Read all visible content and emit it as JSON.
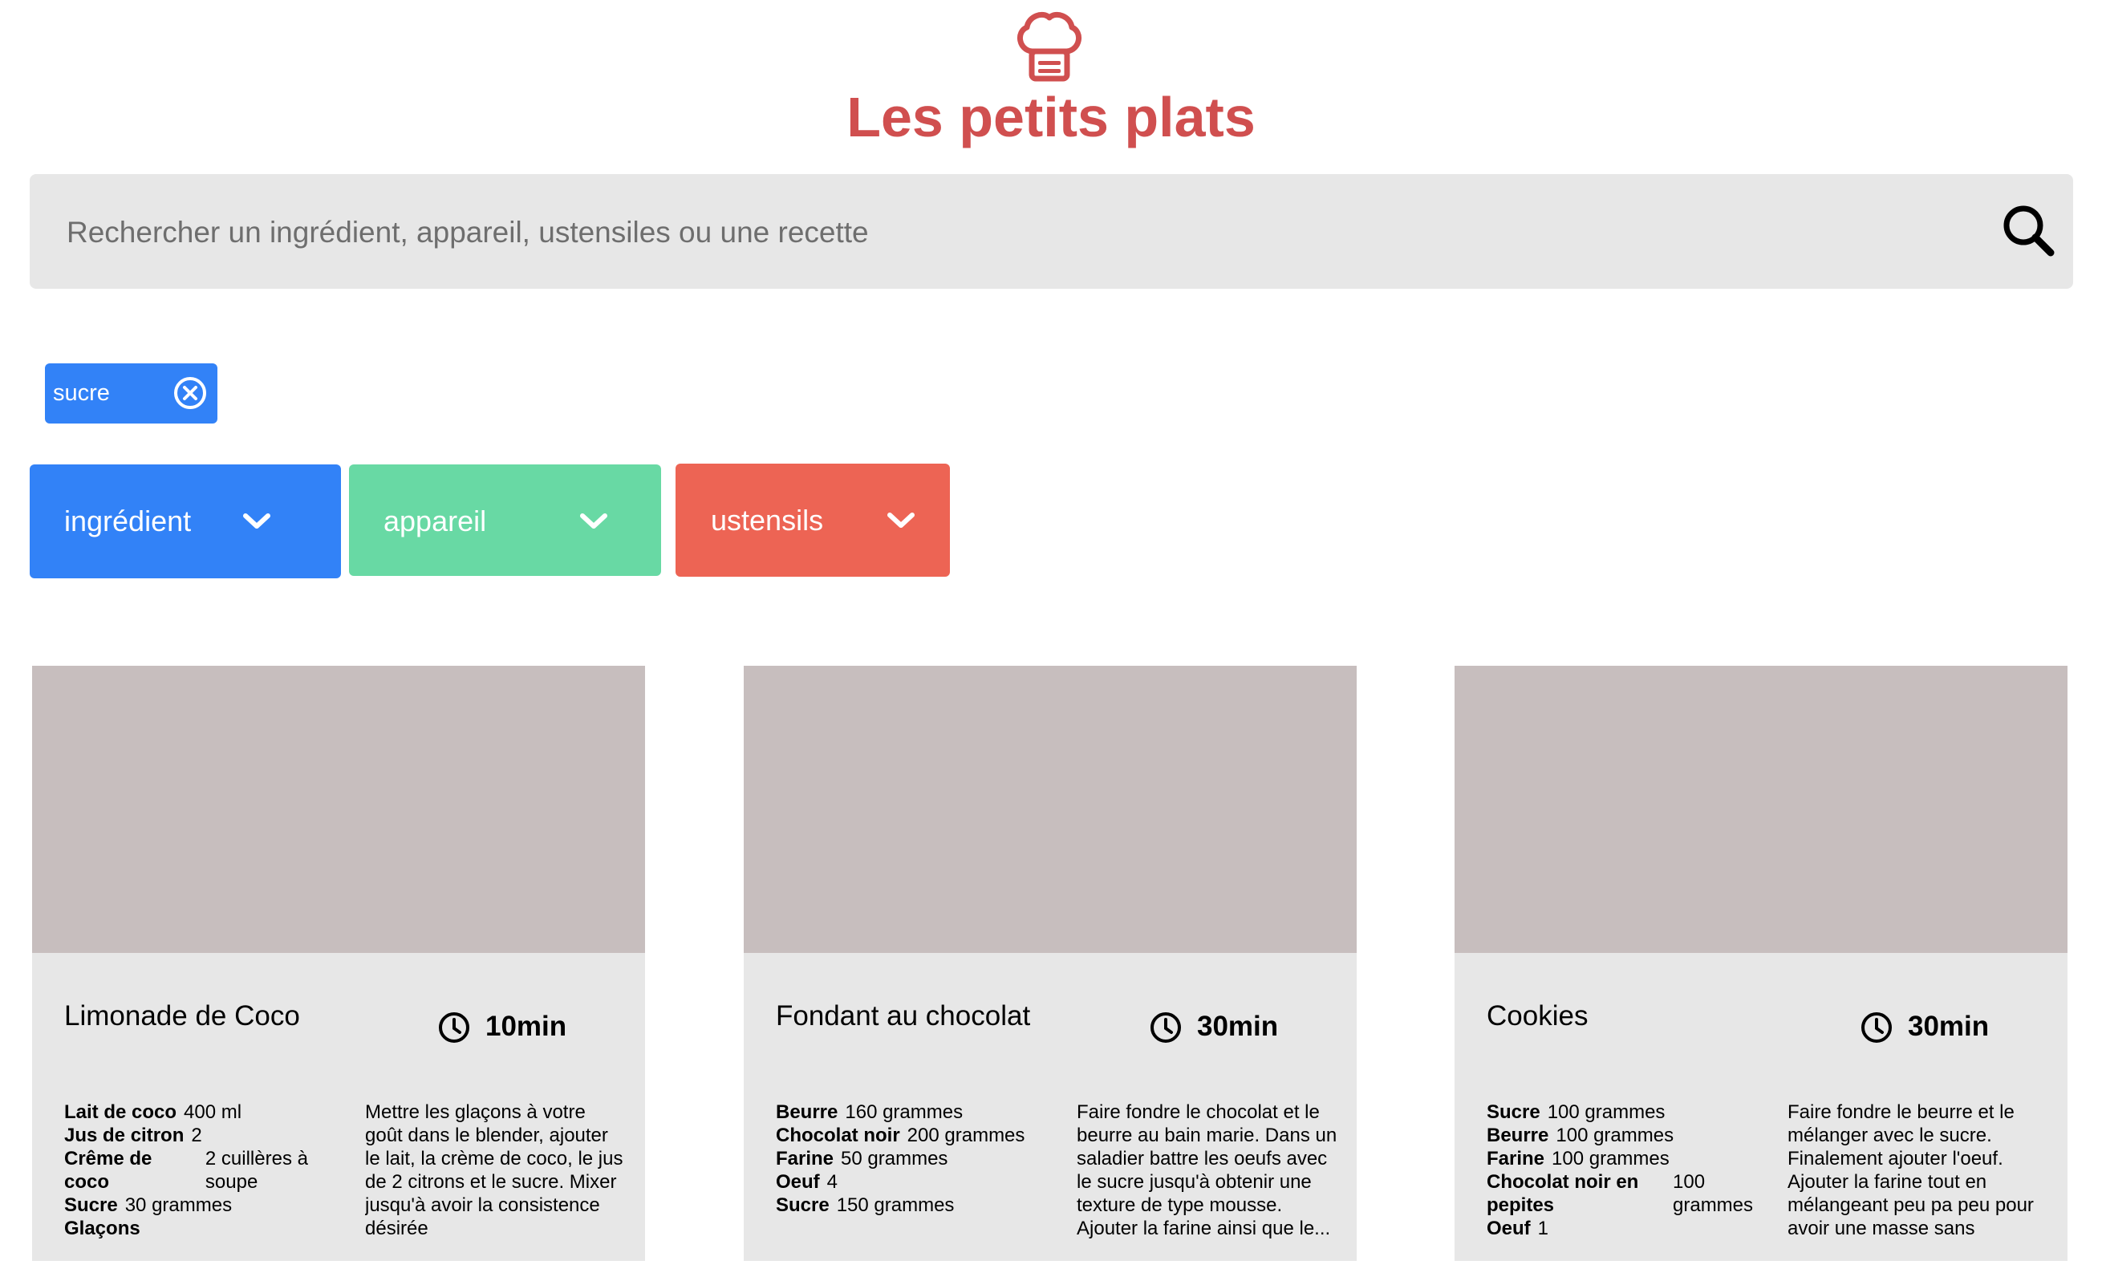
{
  "header": {
    "logo_icon": "chef-hat-icon",
    "title": "Les petits plats",
    "title_color": "#D04F4F"
  },
  "search": {
    "placeholder": "Rechercher un ingrédient, appareil, ustensiles ou une recette",
    "value": "",
    "icon": "search-icon"
  },
  "tags": [
    {
      "label": "sucre",
      "color": "#3282F7",
      "icon": "close-circle-icon"
    }
  ],
  "filters": [
    {
      "label": "ingrédient",
      "color": "#3282F7",
      "icon": "chevron-down-icon"
    },
    {
      "label": "appareil",
      "color": "#68D9A4",
      "icon": "chevron-down-icon"
    },
    {
      "label": "ustensils",
      "color": "#ED6454",
      "icon": "chevron-down-icon"
    }
  ],
  "recipes": [
    {
      "title": "Limonade de Coco",
      "time": "10min",
      "ingredients": [
        {
          "name": "Lait de coco",
          "qty": "400 ml"
        },
        {
          "name": "Jus de citron",
          "qty": "2"
        },
        {
          "name": "Crême de coco",
          "qty": "2 cuillères à soupe"
        },
        {
          "name": "Sucre",
          "qty": "30 grammes"
        },
        {
          "name": "Glaçons",
          "qty": ""
        }
      ],
      "description": "Mettre les glaçons à votre goût dans le blender, ajouter le lait, la crème de coco, le jus de 2 citrons et le sucre. Mixer jusqu'à avoir la consistence désirée"
    },
    {
      "title": "Fondant au chocolat",
      "time": "30min",
      "ingredients": [
        {
          "name": "Beurre",
          "qty": "160 grammes"
        },
        {
          "name": "Chocolat noir",
          "qty": "200 grammes"
        },
        {
          "name": "Farine",
          "qty": "50 grammes"
        },
        {
          "name": "Oeuf",
          "qty": "4"
        },
        {
          "name": "Sucre",
          "qty": "150 grammes"
        }
      ],
      "description": "Faire fondre le chocolat et le beurre au bain marie. Dans un saladier battre les oeufs avec le sucre jusqu'à obtenir une texture de type mousse. Ajouter la farine ainsi que le..."
    },
    {
      "title": "Cookies",
      "time": "30min",
      "ingredients": [
        {
          "name": "Sucre",
          "qty": "100 grammes"
        },
        {
          "name": "Beurre",
          "qty": "100 grammes"
        },
        {
          "name": "Farine",
          "qty": "100 grammes"
        },
        {
          "name": "Chocolat noir en pepites",
          "qty": "100 grammes"
        },
        {
          "name": "Oeuf",
          "qty": "1"
        }
      ],
      "description": "Faire fondre le beurre et le mélanger avec le sucre. Finalement ajouter l'oeuf. Ajouter la farine tout en mélangeant peu pa peu pour avoir une masse sans grumau..."
    }
  ]
}
